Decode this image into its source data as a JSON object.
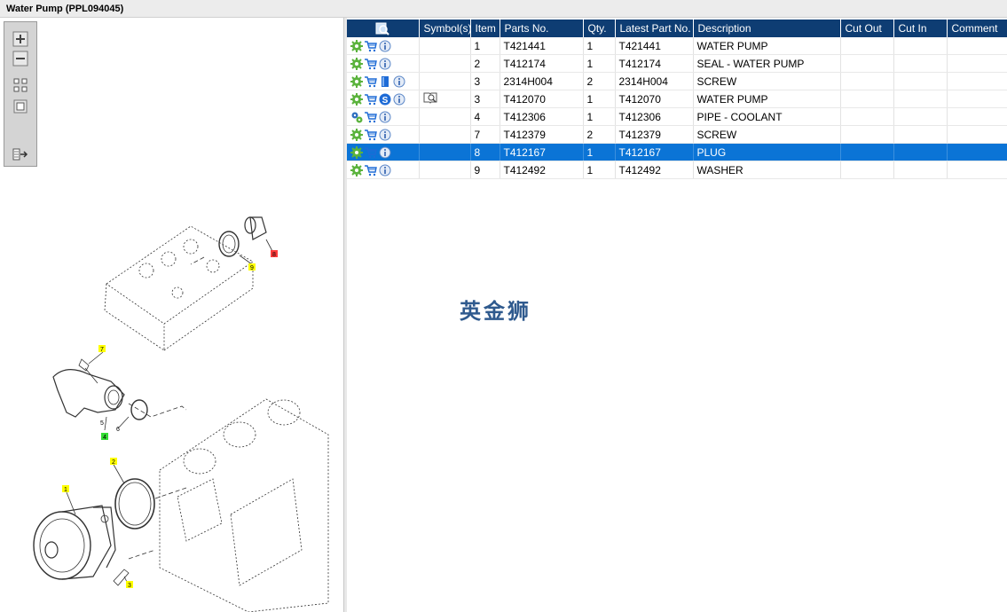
{
  "window": {
    "title": "Water Pump (PPL094045)"
  },
  "toolbar": {
    "buttons": [
      {
        "name": "zoom-in-icon"
      },
      {
        "name": "zoom-out-icon"
      },
      {
        "name": "fit-icon"
      },
      {
        "name": "actual-size-icon"
      },
      {
        "name": "export-icon"
      }
    ]
  },
  "diagram": {
    "callouts": [
      "1",
      "2",
      "3",
      "4",
      "5",
      "6",
      "7",
      "8",
      "9"
    ],
    "colors": {
      "yellow": "#ffff00",
      "green": "#33dd33",
      "red": "#ff3b3b"
    }
  },
  "table": {
    "headers": [
      "",
      "Symbol(s)",
      "Item",
      "Parts No.",
      "Qty.",
      "Latest Part No.",
      "Description",
      "Cut Out",
      "Cut In",
      "Comment"
    ],
    "rows": [
      {
        "item": "1",
        "part": "T421441",
        "qty": "1",
        "latest": "T421441",
        "desc": "WATER PUMP",
        "icons": [
          "gear",
          "cart",
          "info"
        ],
        "symbol": ""
      },
      {
        "item": "2",
        "part": "T412174",
        "qty": "1",
        "latest": "T412174",
        "desc": "SEAL - WATER PUMP",
        "icons": [
          "gear",
          "cart",
          "info"
        ],
        "symbol": ""
      },
      {
        "item": "3",
        "part": "2314H004",
        "qty": "2",
        "latest": "2314H004",
        "desc": "SCREW",
        "icons": [
          "gear",
          "cart",
          "book",
          "info"
        ],
        "symbol": ""
      },
      {
        "item": "3",
        "part": "T412070",
        "qty": "1",
        "latest": "T412070",
        "desc": "WATER PUMP",
        "icons": [
          "gear",
          "cart",
          "s-badge",
          "info"
        ],
        "symbol": "search-book"
      },
      {
        "item": "4",
        "part": "T412306",
        "qty": "1",
        "latest": "T412306",
        "desc": "PIPE - COOLANT",
        "icons": [
          "gears",
          "cart",
          "info"
        ],
        "symbol": ""
      },
      {
        "item": "7",
        "part": "T412379",
        "qty": "2",
        "latest": "T412379",
        "desc": "SCREW",
        "icons": [
          "gear",
          "cart",
          "info"
        ],
        "symbol": ""
      },
      {
        "item": "8",
        "part": "T412167",
        "qty": "1",
        "latest": "T412167",
        "desc": "PLUG",
        "icons": [
          "gear",
          "cart",
          "info"
        ],
        "symbol": "",
        "selected": true
      },
      {
        "item": "9",
        "part": "T412492",
        "qty": "1",
        "latest": "T412492",
        "desc": "WASHER",
        "icons": [
          "gear",
          "cart",
          "info"
        ],
        "symbol": ""
      }
    ],
    "colors": {
      "header": "#0e3d73",
      "selected": "#0b74d6"
    }
  },
  "watermark": {
    "text": "英金狮"
  }
}
